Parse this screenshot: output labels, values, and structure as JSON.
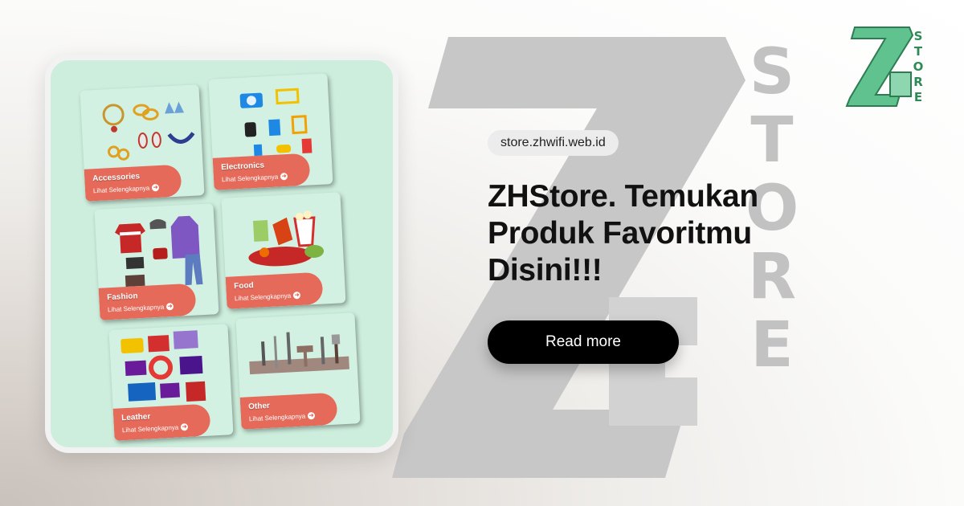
{
  "watermark": {
    "letters": [
      "S",
      "T",
      "O",
      "R",
      "E"
    ]
  },
  "logo": {
    "letters": [
      "S",
      "T",
      "O",
      "R",
      "E"
    ]
  },
  "categories": [
    {
      "title": "Accessories",
      "link": "Lihat Selengkapnya"
    },
    {
      "title": "Electronics",
      "link": "Lihat Selengkapnya"
    },
    {
      "title": "Fashion",
      "link": "Lihat Selengkapnya"
    },
    {
      "title": "Food",
      "link": "Lihat Selengkapnya"
    },
    {
      "title": "Leather",
      "link": "Lihat Selengkapnya"
    },
    {
      "title": "Other",
      "link": "Lihat Selengkapnya"
    }
  ],
  "site": {
    "url": "store.zhwifi.web.id"
  },
  "headline": {
    "line1": "ZHStore. Temukan",
    "line2": "Produk Favoritmu",
    "line3": "Disini!!!"
  },
  "cta": {
    "label": "Read more"
  },
  "colors": {
    "tablet_bg": "#cdeedd",
    "ribbon": "#e66a5a",
    "logo_green": "#5fc28f",
    "watermark_gray": "#c2c2c2",
    "button_bg": "#000000"
  }
}
